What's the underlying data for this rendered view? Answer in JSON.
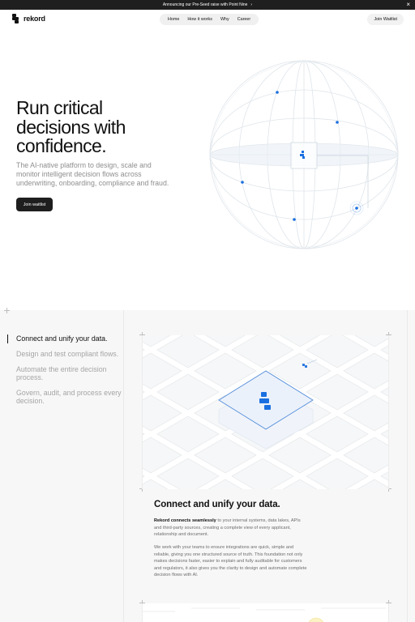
{
  "announcement": {
    "text": "Announcing our Pre-Seed raise with Point Nine",
    "arrow_icon": "chevron-right-icon",
    "close_icon": "close-icon"
  },
  "nav": {
    "logo_text": "rekord",
    "menu": [
      "Home",
      "How it works",
      "Why",
      "Career"
    ],
    "cta": "Join Waitlist"
  },
  "hero": {
    "title": "Run critical decisions with confidence.",
    "subtitle": "The AI-native platform to design, scale and monitor intelligent decision flows across underwriting, onboarding, compliance and fraud.",
    "button": "Join waitlist"
  },
  "colors": {
    "accent": "#1a6fe0",
    "dark_button": "#1e1e1e",
    "section_bg": "#f7f7f7"
  },
  "features": {
    "steps": [
      "Connect and unify your data.",
      "Design and test compliant flows.",
      "Automate the entire decision process.",
      "Govern, audit, and process every decision."
    ],
    "active_step": 0,
    "card": {
      "title": "Connect and unify your data.",
      "p1_lead": "Rekord connects seamlessly",
      "p1_rest": " to your internal systems, data lakes, APIs and third-party sources, creating a complete view of every applicant, relationship and document.",
      "p2": "We work with your teams to ensure integrations are quick, simple and reliable, giving you one structured source of truth. This foundation not only makes decisions faster, easier to explain and fully auditable for customers and regulators, it also gives you the clarity to design and automate complete decision flows with AI."
    }
  }
}
